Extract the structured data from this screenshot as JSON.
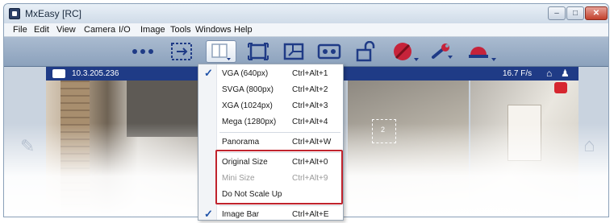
{
  "window": {
    "title": "MxEasy [RC]",
    "min_glyph": "–",
    "max_glyph": "□",
    "close_glyph": "✕"
  },
  "menubar": {
    "items": [
      "File",
      "Edit",
      "View",
      "Camera",
      "I/O",
      "Image",
      "Tools",
      "Windows",
      "Help"
    ]
  },
  "toolbar": {
    "icons": [
      "more-dots-icon",
      "grid-arrows-icon",
      "layout-icon",
      "fit-frame-icon",
      "resize-icon",
      "cassette-icon",
      "unlock-icon",
      "no-alarm-icon",
      "wrench-icon",
      "siren-icon"
    ]
  },
  "camera": {
    "ip": "10.3.205.236",
    "fps": "16.7 F/s",
    "tile_number": "2"
  },
  "dropdown": {
    "items": [
      {
        "label": "VGA (640px)",
        "shortcut": "Ctrl+Alt+1",
        "checked": true,
        "disabled": false
      },
      {
        "label": "SVGA (800px)",
        "shortcut": "Ctrl+Alt+2",
        "checked": false,
        "disabled": false
      },
      {
        "label": "XGA (1024px)",
        "shortcut": "Ctrl+Alt+3",
        "checked": false,
        "disabled": false
      },
      {
        "label": "Mega (1280px)",
        "shortcut": "Ctrl+Alt+4",
        "checked": false,
        "disabled": false
      },
      {
        "label": "Panorama",
        "shortcut": "Ctrl+Alt+W",
        "checked": false,
        "disabled": false
      },
      {
        "label": "Original Size",
        "shortcut": "Ctrl+Alt+0",
        "checked": false,
        "disabled": false
      },
      {
        "label": "Mini Size",
        "shortcut": "Ctrl+Alt+9",
        "checked": false,
        "disabled": true
      },
      {
        "label": "Do Not Scale Up",
        "shortcut": "",
        "checked": false,
        "disabled": false
      },
      {
        "label": "Image Bar",
        "shortcut": "Ctrl+Alt+E",
        "checked": true,
        "disabled": false
      }
    ],
    "check_glyph": "✓"
  },
  "colors": {
    "accent_blue": "#1f3b86",
    "highlight_red": "#c0232d",
    "toolbar_bg": "#8ba1bc"
  }
}
